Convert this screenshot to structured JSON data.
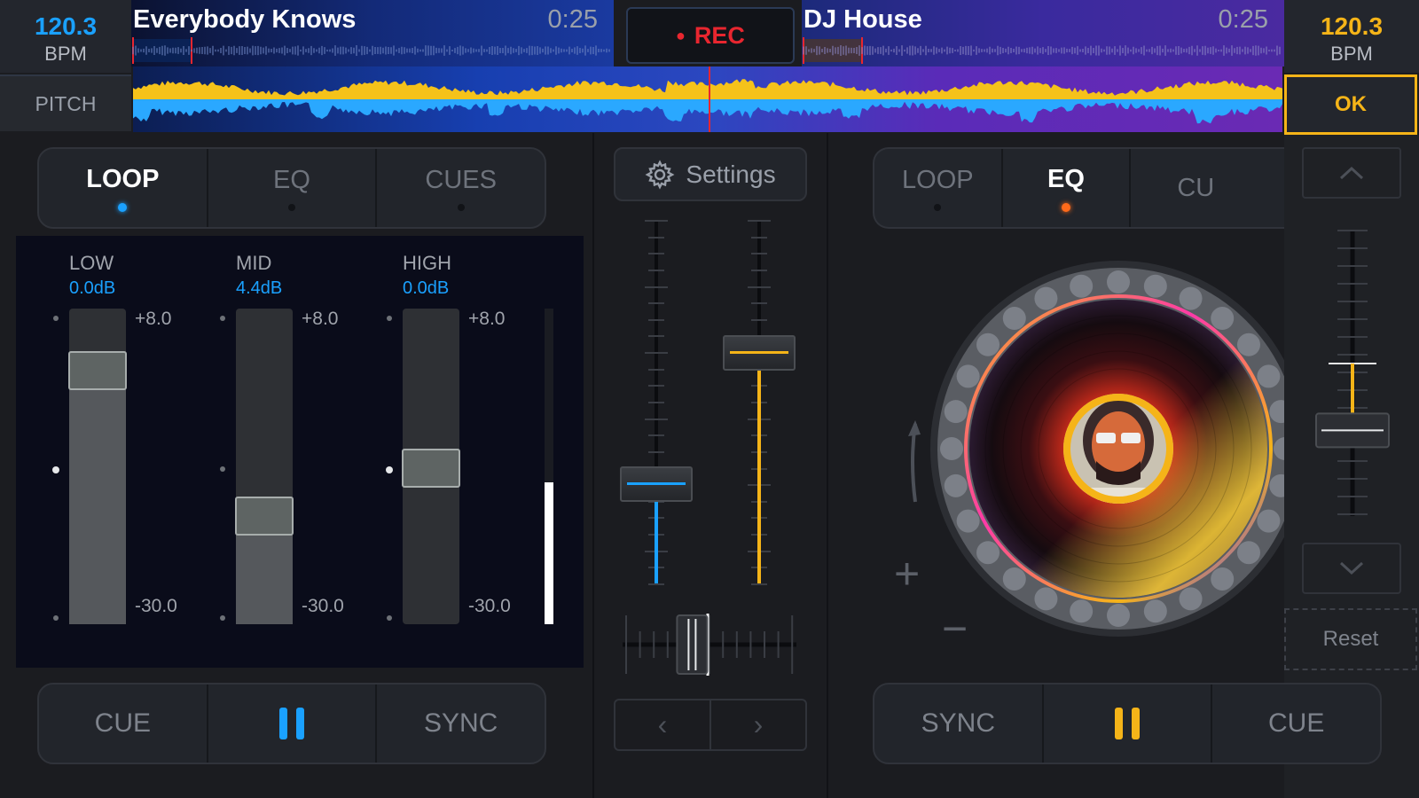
{
  "left_deck": {
    "bpm": "120.3",
    "bpm_label": "BPM",
    "pitch_label": "PITCH",
    "track_title": "Everybody Knows",
    "time": "0:25",
    "accent_color": "#1aa1ff",
    "tabs": [
      {
        "label": "LOOP",
        "active": true
      },
      {
        "label": "EQ",
        "active": false
      },
      {
        "label": "CUES",
        "active": false
      }
    ],
    "eq": [
      {
        "name": "LOW",
        "value": "0.0dB",
        "max": "+8.0",
        "min": "-30.0"
      },
      {
        "name": "MID",
        "value": "4.4dB",
        "max": "+8.0",
        "min": "-30.0"
      },
      {
        "name": "HIGH",
        "value": "0.0dB",
        "max": "+8.0",
        "min": "-30.0"
      }
    ],
    "level_meter": 0.45,
    "transport": {
      "cue": "CUE",
      "sync": "SYNC",
      "play_icon": "pause-icon"
    }
  },
  "right_deck": {
    "bpm": "120.3",
    "bpm_label": "BPM",
    "ok_label": "OK",
    "track_title": "DJ House",
    "time": "0:25",
    "accent_color": "#f5b418",
    "tabs": [
      {
        "label": "LOOP",
        "active": false
      },
      {
        "label": "EQ",
        "active": true
      },
      {
        "label": "CU",
        "active": false
      }
    ],
    "reset_label": "Reset",
    "plus": "+",
    "minus": "−",
    "transport": {
      "sync": "SYNC",
      "cue": "CUE",
      "play_icon": "pause-icon"
    },
    "pitch_slider": 0.7
  },
  "mixer": {
    "rec_label": "REC",
    "rec_color": "#e8262f",
    "settings_label": "Settings",
    "settings_icon": "gear-icon",
    "left_volume": 0.25,
    "right_volume": 0.65,
    "crossfader": 0.4,
    "nav_prev": "‹",
    "nav_next": "›"
  }
}
